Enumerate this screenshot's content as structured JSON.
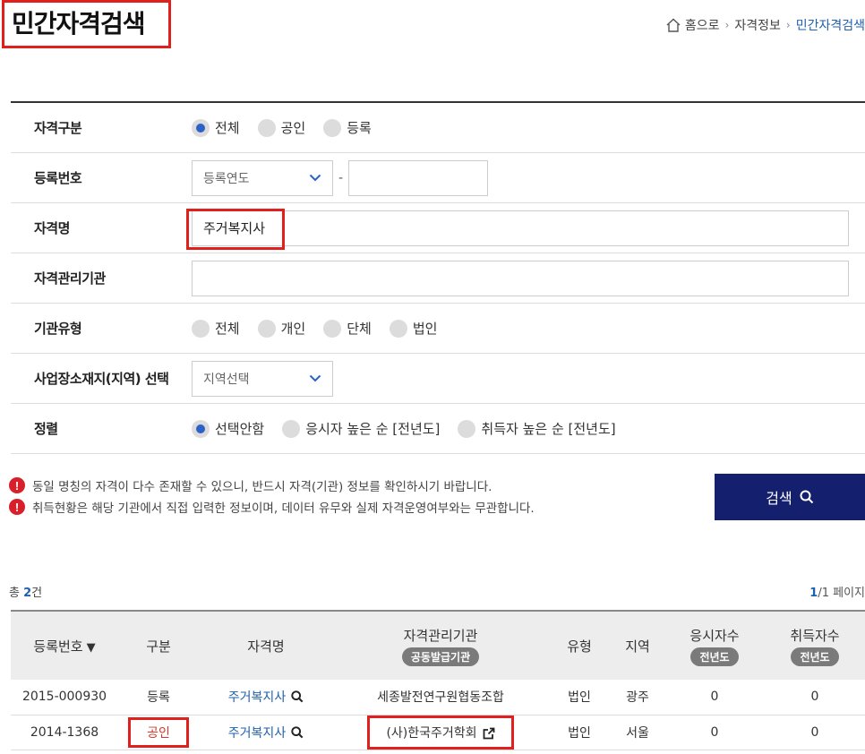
{
  "page_title": "민간자격검색",
  "breadcrumb": {
    "home": "홈으로",
    "level1": "자격정보",
    "current": "민간자격검색"
  },
  "form": {
    "category": {
      "label": "자격구분",
      "options": [
        "전체",
        "공인",
        "등록"
      ],
      "selected": "전체"
    },
    "reg_number": {
      "label": "등록번호",
      "year_select": "등록연도",
      "separator": "-",
      "number_value": ""
    },
    "qual_name": {
      "label": "자격명",
      "value": "주거복지사"
    },
    "org": {
      "label": "자격관리기관",
      "value": ""
    },
    "org_type": {
      "label": "기관유형",
      "options": [
        "전체",
        "개인",
        "단체",
        "법인"
      ],
      "selected": ""
    },
    "region": {
      "label": "사업장소재지(지역) 선택",
      "select": "지역선택"
    },
    "sort": {
      "label": "정렬",
      "options": [
        "선택안함",
        "응시자 높은 순 [전년도]",
        "취득자 높은 순 [전년도]"
      ],
      "selected": "선택안함"
    }
  },
  "notices": [
    "동일 명칭의 자격이 다수 존재할 수 있으니, 반드시 자격(기관) 정보를 확인하시기 바랍니다.",
    "취득현황은 해당 기관에서 직접 입력한 정보이며, 데이터 유무와 실제 자격운영여부와는 무관합니다."
  ],
  "search_button": "검색",
  "results": {
    "total_prefix": "총",
    "total_count": "2",
    "total_suffix": "건",
    "page_current": "1",
    "page_total": "/1 페이지",
    "columns": {
      "reg_no": "등록번호",
      "sort_arrow": "▼",
      "category": "구분",
      "qual_name": "자격명",
      "org": "자격관리기관",
      "org_pill": "공동발급기관",
      "type": "유형",
      "region": "지역",
      "applicants": "응시자수",
      "applicants_pill": "전년도",
      "acquirers": "취득자수",
      "acquirers_pill": "전년도"
    },
    "rows": [
      {
        "reg_no": "2015-000930",
        "category": "등록",
        "qual_name": "주거복지사",
        "org": "세종발전연구원협동조합",
        "type": "법인",
        "region": "광주",
        "applicants": "0",
        "acquirers": "0"
      },
      {
        "reg_no": "2014-1368",
        "category": "공인",
        "qual_name": "주거복지사",
        "org": "(사)한국주거학회",
        "type": "법인",
        "region": "서울",
        "applicants": "0",
        "acquirers": "0"
      }
    ]
  },
  "colors": {
    "accent": "#1f5fae",
    "button": "#14206e",
    "highlight": "#e0201c",
    "radio_on": "#2a62c8"
  }
}
